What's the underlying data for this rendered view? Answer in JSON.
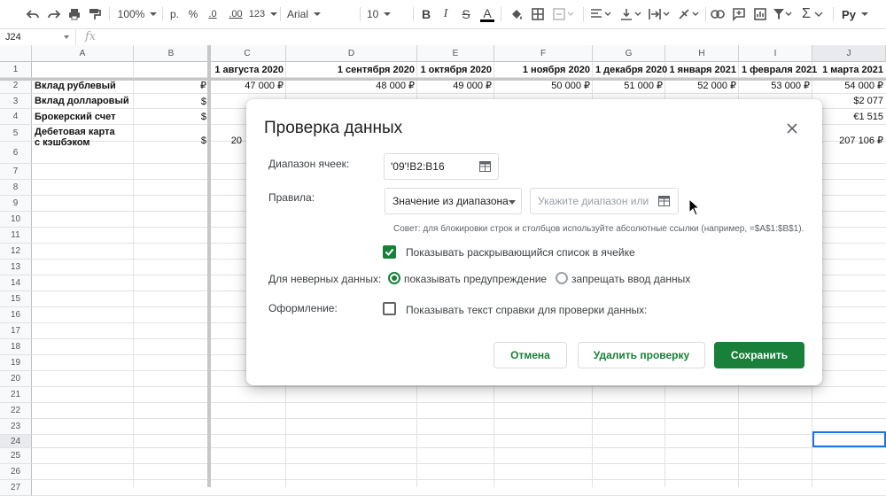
{
  "toolbar": {
    "zoom": "100%",
    "currency": "р.",
    "percent": "%",
    "dec_less": ".0",
    "dec_more": ".00",
    "format_more": "123",
    "font": "Arial",
    "font_size": "10",
    "bold": "B",
    "italic": "I",
    "strike": "S",
    "text_color": "A",
    "input_tools": "Ру"
  },
  "formula_bar": {
    "name_box": "J24",
    "fx": "fx"
  },
  "grid": {
    "columns": [
      "A",
      "B",
      "C",
      "D",
      "E",
      "F",
      "G",
      "H",
      "I",
      "J"
    ],
    "rows": [
      "1",
      "2",
      "3",
      "4",
      "5",
      "6",
      "7",
      "8",
      "9",
      "10",
      "11",
      "12",
      "13",
      "14",
      "15",
      "16",
      "17",
      "18",
      "19",
      "20",
      "21",
      "22",
      "23",
      "24",
      "25",
      "26",
      "27"
    ],
    "headers_row1": [
      "1 августа 2020",
      "1 сентября 2020",
      "1 октября 2020",
      "1 ноября 2020",
      "1 декабря 2020",
      "1 января 2021",
      "1 февраля 2021",
      "1 марта 2021"
    ],
    "row_labels": [
      "Вклад рублевый",
      "Вклад долларовый",
      "Брокерский счет",
      "Дебетовая карта\nс кэшбэком"
    ],
    "currency_b": [
      "₽",
      "$",
      "$",
      "$"
    ],
    "row2_values": [
      "47 000 ₽",
      "48 000 ₽",
      "49 000 ₽",
      "50 000 ₽",
      "51 000 ₽",
      "52 000 ₽",
      "53 000 ₽",
      "54 000 ₽"
    ],
    "j3": "$2 077",
    "j4": "€1 515",
    "j5": "207 106 ₽",
    "c5_partial": "20"
  },
  "dialog": {
    "title": "Проверка данных",
    "range_label": "Диапазон ячеек:",
    "range_value": "'09'!B2:B16",
    "rules_label": "Правила:",
    "rule_type": "Значение из диапазона",
    "rule_range_placeholder": "Укажите диапазон или",
    "hint": "Совет: для блокировки строк и столбцов используйте абсолютные ссылки (например, =$A$1:$B$1).",
    "show_dropdown_label": "Показывать раскрывающийся список в ячейке",
    "show_dropdown_checked": true,
    "invalid_label": "Для неверных данных:",
    "invalid_options": [
      "показывать предупреждение",
      "запрещать ввод данных"
    ],
    "invalid_selected": "показывать предупреждение",
    "appearance_label": "Оформление:",
    "help_text_label": "Показывать текст справки для проверки данных:",
    "help_text_checked": false,
    "buttons": {
      "cancel": "Отмена",
      "remove": "Удалить проверку",
      "save": "Сохранить"
    }
  },
  "colors": {
    "accent_green": "#188038",
    "selection_blue": "#1a73e8"
  }
}
